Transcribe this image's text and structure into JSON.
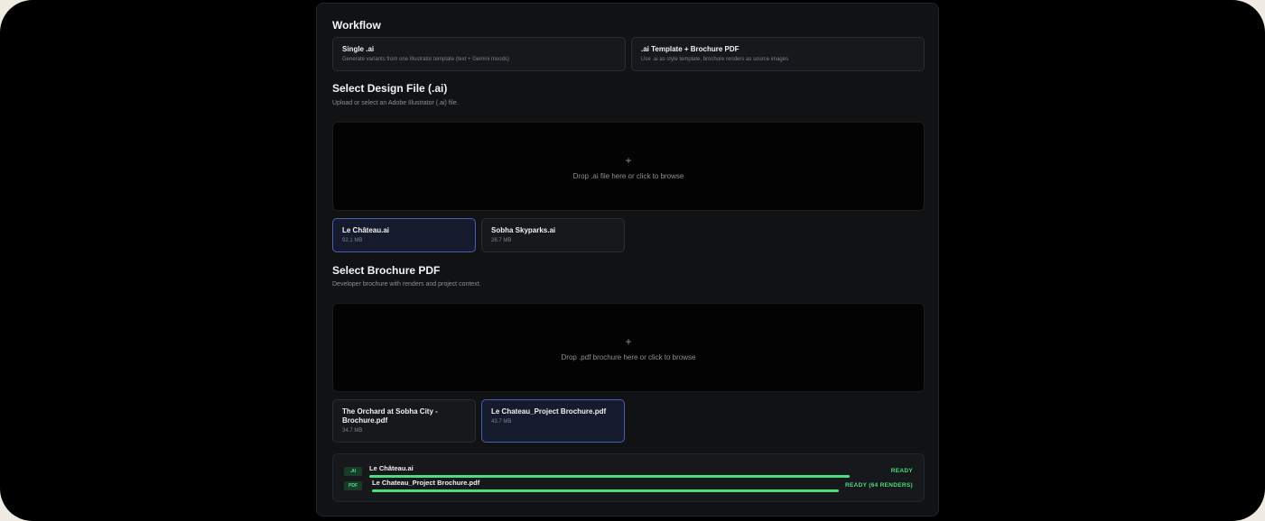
{
  "workflow": {
    "title": "Workflow",
    "options": [
      {
        "label": "Single .ai",
        "desc": "Generate variants from one Illustrator template (text + Gemini moods)"
      },
      {
        "label": ".ai Template + Brochure PDF",
        "desc": "Use .ai as style template, brochure renders as source images"
      }
    ]
  },
  "design": {
    "title": "Select Design File (.ai)",
    "subtitle": "Upload or select an Adobe Illustrator (.ai) file.",
    "drop_icon": "+",
    "drop_text": "Drop .ai file here or click to browse",
    "files": [
      {
        "name": "Le Château.ai",
        "size": "92.1 MB",
        "selected": true
      },
      {
        "name": "Sobha Skyparks.ai",
        "size": "26.7 MB",
        "selected": false
      }
    ]
  },
  "brochure": {
    "title": "Select Brochure PDF",
    "subtitle": "Developer brochure with renders and project context.",
    "drop_icon": "+",
    "drop_text": "Drop .pdf brochure here or click to browse",
    "files": [
      {
        "name": "The Orchard at Sobha City - Brochure.pdf",
        "size": "34.7 MB",
        "selected": false
      },
      {
        "name": "Le Chateau_Project Brochure.pdf",
        "size": "43.7 MB",
        "selected": true
      }
    ]
  },
  "status": {
    "items": [
      {
        "tag": ".AI",
        "name": "Le Château.ai",
        "state": "READY",
        "progress": 1.0
      },
      {
        "tag": "PDF",
        "name": "Le Chateau_Project Brochure.pdf",
        "state": "READY (64 RENDERS)",
        "progress": 1.0
      }
    ],
    "accent": "#4ade80"
  },
  "colors": {
    "background": "#000000",
    "panel": "#111214",
    "selected_border": "#4b5fb6",
    "ready": "#4ade80"
  }
}
